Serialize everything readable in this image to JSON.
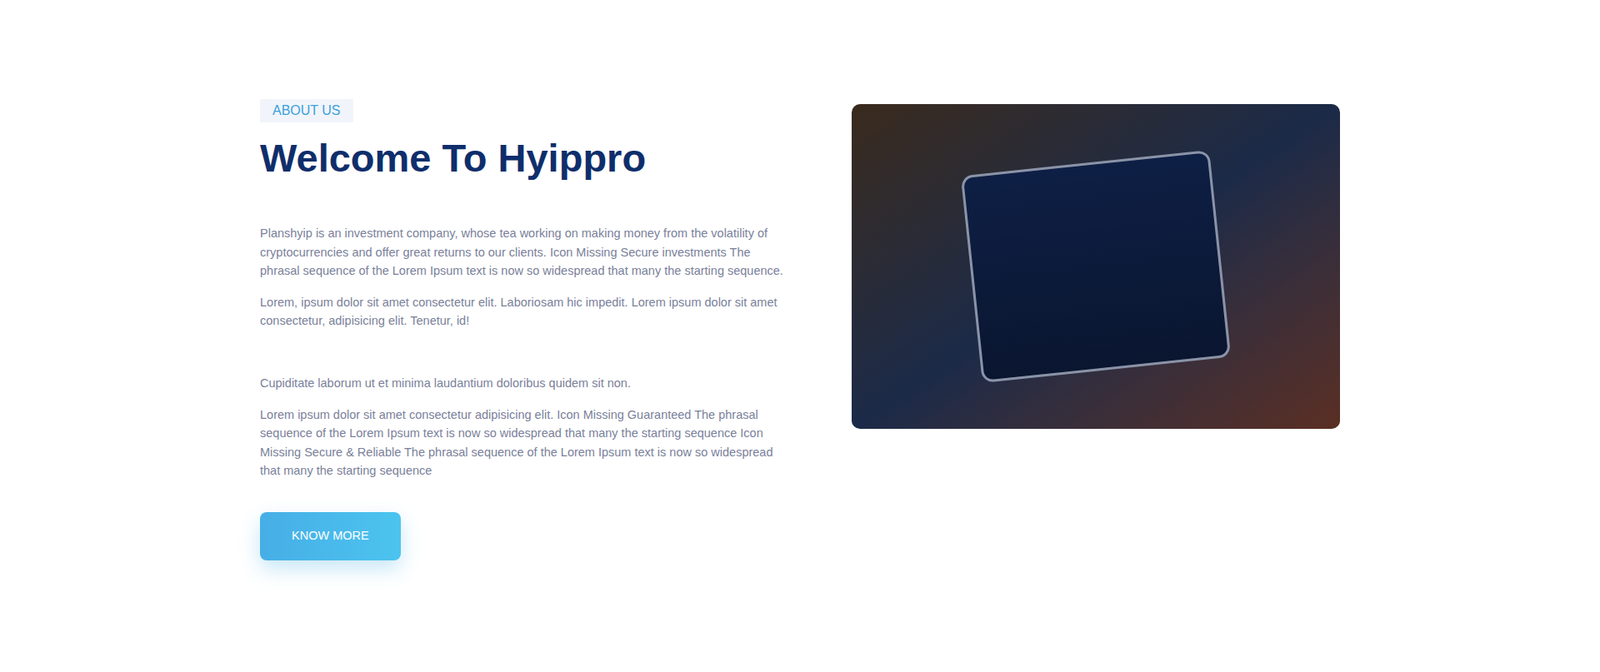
{
  "section": {
    "badge": "ABOUT US",
    "heading": "Welcome To Hyippro",
    "paragraph_groups": [
      [
        "Planshyip is an investment company, whose tea working on making money from the volatility of cryptocurrencies and offer great returns to our clients. Icon Missing Secure investments The phrasal sequence of the Lorem Ipsum text is now so widespread that many the starting sequence.",
        "Lorem, ipsum dolor sit amet consectetur elit. Laboriosam hic impedit. Lorem ipsum dolor sit amet consectetur, adipisicing elit. Tenetur, id!"
      ],
      [
        "Cupiditate laborum ut et minima laudantium doloribus quidem sit non.",
        "Lorem ipsum dolor sit amet consectetur adipisicing elit. Icon Missing Guaranteed The phrasal sequence of the Lorem Ipsum text is now so widespread that many the starting sequence Icon Missing Secure & Reliable The phrasal sequence of the Lorem Ipsum text is now so widespread that many the starting sequence"
      ]
    ],
    "button": "KNOW MORE"
  }
}
